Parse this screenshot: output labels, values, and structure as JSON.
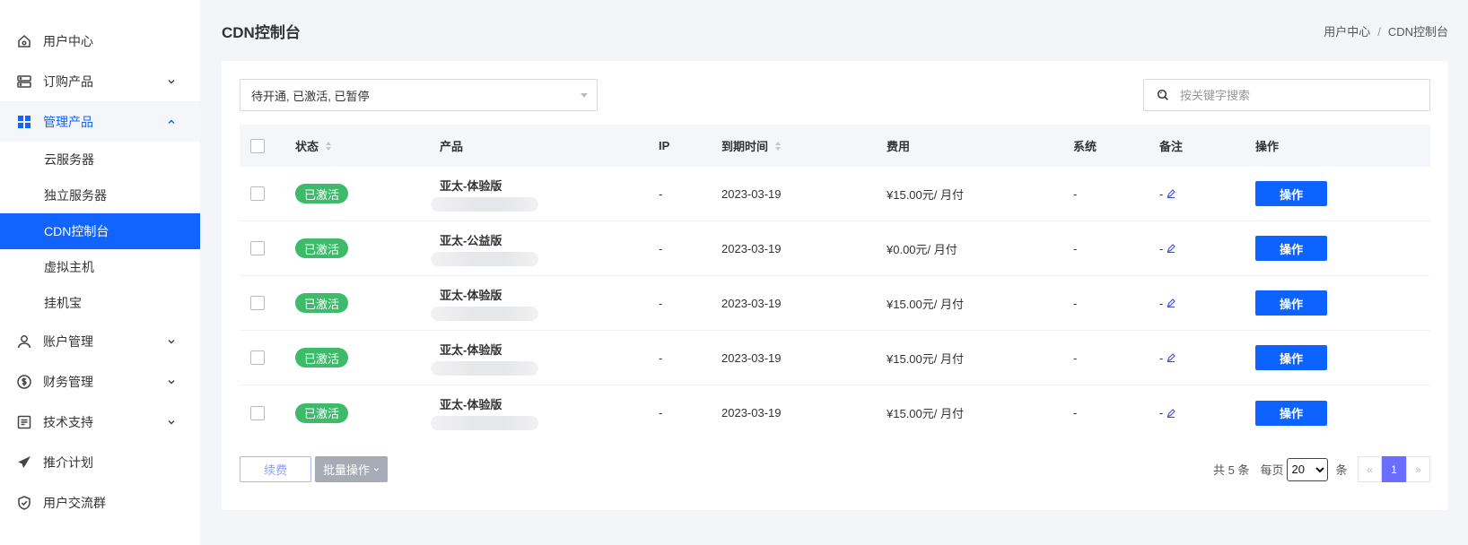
{
  "sidebar": {
    "items": [
      {
        "label": "用户中心",
        "icon": "home-icon"
      },
      {
        "label": "订购产品",
        "icon": "server-icon"
      },
      {
        "label": "管理产品",
        "icon": "grid-icon"
      },
      {
        "label": "账户管理",
        "icon": "user-icon"
      },
      {
        "label": "财务管理",
        "icon": "dollar-icon"
      },
      {
        "label": "技术支持",
        "icon": "document-icon"
      },
      {
        "label": "推介计划",
        "icon": "paper-plane-icon"
      },
      {
        "label": "用户交流群",
        "icon": "shield-icon"
      }
    ],
    "sub_items": [
      {
        "label": "云服务器"
      },
      {
        "label": "独立服务器"
      },
      {
        "label": "CDN控制台"
      },
      {
        "label": "虚拟主机"
      },
      {
        "label": "挂机宝"
      }
    ]
  },
  "header": {
    "title": "CDN控制台",
    "breadcrumb": [
      "用户中心",
      "/",
      "CDN控制台"
    ]
  },
  "filter": {
    "value": "待开通, 已激活, 已暂停"
  },
  "search": {
    "placeholder": "按关键字搜索"
  },
  "table": {
    "columns": [
      "状态",
      "产品",
      "IP",
      "到期时间",
      "费用",
      "系统",
      "备注",
      "操作"
    ],
    "rows": [
      {
        "status": "已激活",
        "product": "亚太-体验版",
        "ip": "-",
        "expire": "2023-03-19",
        "fee": "¥15.00元/ 月付",
        "system": "-",
        "note": "-",
        "action": "操作"
      },
      {
        "status": "已激活",
        "product": "亚太-公益版",
        "ip": "-",
        "expire": "2023-03-19",
        "fee": "¥0.00元/ 月付",
        "system": "-",
        "note": "-",
        "action": "操作"
      },
      {
        "status": "已激活",
        "product": "亚太-体验版",
        "ip": "-",
        "expire": "2023-03-19",
        "fee": "¥15.00元/ 月付",
        "system": "-",
        "note": "-",
        "action": "操作"
      },
      {
        "status": "已激活",
        "product": "亚太-体验版",
        "ip": "-",
        "expire": "2023-03-19",
        "fee": "¥15.00元/ 月付",
        "system": "-",
        "note": "-",
        "action": "操作"
      },
      {
        "status": "已激活",
        "product": "亚太-体验版",
        "ip": "-",
        "expire": "2023-03-19",
        "fee": "¥15.00元/ 月付",
        "system": "-",
        "note": "-",
        "action": "操作"
      }
    ]
  },
  "footer": {
    "renew_label": "续费",
    "batch_label": "批量操作",
    "total_text": "共 5 条",
    "per_page_label": "每页",
    "per_page_value": "20",
    "per_page_unit": "条",
    "pager_prev": "«",
    "pager_current": "1",
    "pager_next": "»"
  },
  "colors": {
    "primary": "#1264ff",
    "active_badge": "#3dbb6a",
    "pager_current": "#6a6dff"
  }
}
